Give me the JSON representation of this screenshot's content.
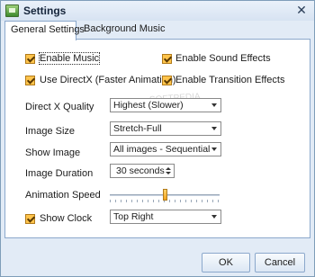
{
  "window": {
    "title": "Settings",
    "close_glyph": "✕"
  },
  "tabs": [
    {
      "label": "General Settings"
    },
    {
      "label": "Background Music"
    }
  ],
  "options": {
    "enable_music": "Enable Music",
    "enable_sound_effects": "Enable Sound Effects",
    "use_directx": "Use DirectX (Faster Animation)",
    "enable_transition_effects": "Enable Transition Effects",
    "show_clock": "Show Clock"
  },
  "fields": {
    "directx_quality": {
      "label": "Direct X Quality",
      "value": "Highest (Slower)"
    },
    "image_size": {
      "label": "Image Size",
      "value": "Stretch-Full"
    },
    "show_image": {
      "label": "Show Image",
      "value": "All images - Sequential"
    },
    "image_duration": {
      "label": "Image Duration",
      "value": "30 seconds"
    },
    "animation_speed": {
      "label": "Animation Speed",
      "level": 0.5
    },
    "clock_position": {
      "value": "Top Right"
    }
  },
  "footer": {
    "ok": "OK",
    "cancel": "Cancel"
  },
  "watermark": "SOFTPEDIA"
}
